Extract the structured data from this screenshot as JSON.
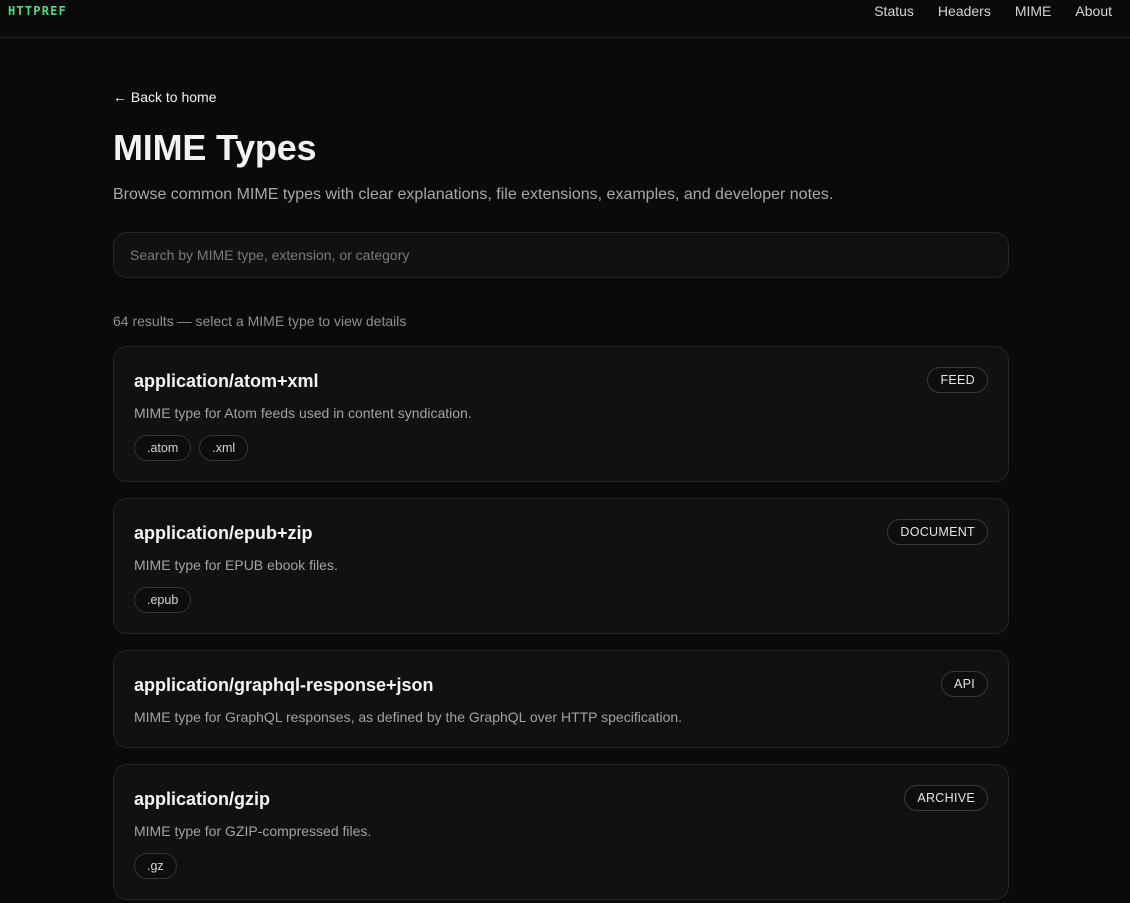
{
  "brand": {
    "logo": "HTTPREF"
  },
  "nav": [
    {
      "label": "Status"
    },
    {
      "label": "Headers"
    },
    {
      "label": "MIME"
    },
    {
      "label": "About"
    }
  ],
  "back_link": "← Back to home",
  "page": {
    "title": "MIME Types",
    "subtitle": "Browse common MIME types with clear explanations, file extensions, examples, and developer notes."
  },
  "search": {
    "placeholder": "Search by MIME type, extension, or category",
    "value": ""
  },
  "results_summary": "64 results — select a MIME type to view details",
  "mime_types": [
    {
      "type": "application/atom+xml",
      "description": "MIME type for Atom feeds used in content syndication.",
      "category": "FEED",
      "extensions": [
        ".atom",
        ".xml"
      ]
    },
    {
      "type": "application/epub+zip",
      "description": "MIME type for EPUB ebook files.",
      "category": "DOCUMENT",
      "extensions": [
        ".epub"
      ]
    },
    {
      "type": "application/graphql-response+json",
      "description": "MIME type for GraphQL responses, as defined by the GraphQL over HTTP specification.",
      "category": "API",
      "extensions": []
    },
    {
      "type": "application/gzip",
      "description": "MIME type for GZIP-compressed files.",
      "category": "ARCHIVE",
      "extensions": [
        ".gz"
      ]
    }
  ]
}
